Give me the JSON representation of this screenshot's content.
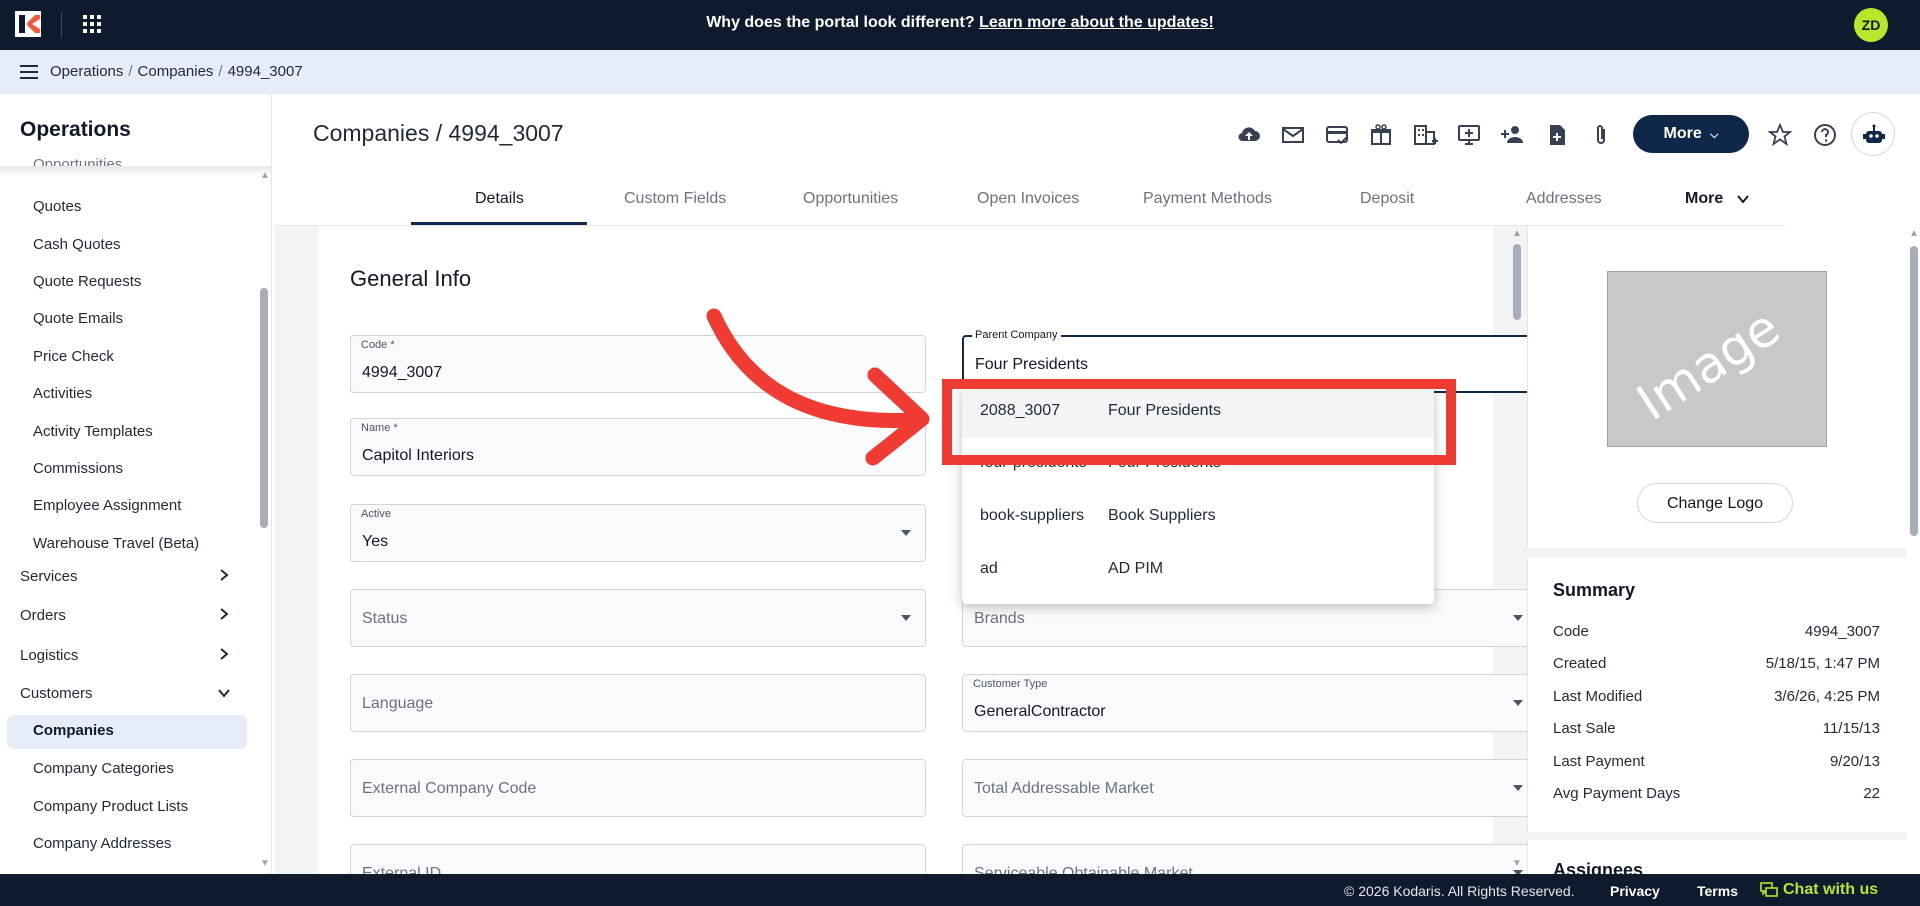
{
  "banner": {
    "question": "Why does the portal look different?",
    "link": "Learn more about the updates!"
  },
  "user": {
    "initials": "ZD"
  },
  "breadcrumb": [
    "Operations",
    "Companies",
    "4994_3007"
  ],
  "sidebar": {
    "title": "Operations",
    "clipped_item": "Opportunities",
    "items": [
      {
        "label": "Quotes"
      },
      {
        "label": "Cash Quotes"
      },
      {
        "label": "Quote Requests"
      },
      {
        "label": "Quote Emails"
      },
      {
        "label": "Price Check"
      },
      {
        "label": "Activities"
      },
      {
        "label": "Activity Templates"
      },
      {
        "label": "Commissions"
      },
      {
        "label": "Employee Assignment"
      },
      {
        "label": "Warehouse Travel (Beta)"
      }
    ],
    "sections": [
      {
        "label": "Services"
      },
      {
        "label": "Orders"
      },
      {
        "label": "Logistics"
      },
      {
        "label": "Customers"
      }
    ],
    "customer_items": [
      {
        "label": "Companies"
      },
      {
        "label": "Company Categories"
      },
      {
        "label": "Company Product Lists"
      },
      {
        "label": "Company Addresses"
      }
    ]
  },
  "page": {
    "title": "Companies / 4994_3007",
    "more_label": "More"
  },
  "toolbar_icons": [
    "cloud-upload-icon",
    "mail-icon",
    "payment-card-icon",
    "gift-icon",
    "buildings-icon",
    "add-presentation-icon",
    "add-person-icon",
    "add-document-icon",
    "paperclip-icon"
  ],
  "tabs": [
    {
      "label": "Details"
    },
    {
      "label": "Custom Fields"
    },
    {
      "label": "Opportunities"
    },
    {
      "label": "Open Invoices"
    },
    {
      "label": "Payment Methods"
    },
    {
      "label": "Deposit"
    },
    {
      "label": "Addresses"
    }
  ],
  "tabs_more": "More",
  "general_info": {
    "title": "General Info",
    "code": {
      "label": "Code *",
      "value": "4994_3007"
    },
    "name": {
      "label": "Name *",
      "value": "Capitol Interiors"
    },
    "active": {
      "label": "Active",
      "value": "Yes"
    },
    "status": {
      "placeholder": "Status"
    },
    "language": {
      "placeholder": "Language"
    },
    "external_code": {
      "placeholder": "External Company Code"
    },
    "external_id": {
      "placeholder": "External ID"
    },
    "parent_company": {
      "label": "Parent Company",
      "value": "Four Presidents"
    },
    "brands": {
      "placeholder": "Brands"
    },
    "customer_type": {
      "label": "Customer Type",
      "value": "GeneralContractor"
    },
    "tam": {
      "placeholder": "Total Addressable Market"
    },
    "som": {
      "placeholder": "Serviceable Obtainable Market"
    }
  },
  "dropdown_options": [
    {
      "code": "2088_3007",
      "name": "Four Presidents"
    },
    {
      "code": "four-presidents",
      "name": "Four Presidents"
    },
    {
      "code": "book-suppliers",
      "name": "Book Suppliers"
    },
    {
      "code": "ad",
      "name": "AD PIM"
    }
  ],
  "logo_panel": {
    "placeholder_text": "Image",
    "change_label": "Change Logo"
  },
  "summary": {
    "title": "Summary",
    "rows": [
      {
        "label": "Code",
        "value": "4994_3007"
      },
      {
        "label": "Created",
        "value": "5/18/15, 1:47 PM"
      },
      {
        "label": "Last Modified",
        "value": "3/6/26, 4:25 PM"
      },
      {
        "label": "Last Sale",
        "value": "11/15/13"
      },
      {
        "label": "Last Payment",
        "value": "9/20/13"
      },
      {
        "label": "Avg Payment Days",
        "value": "22"
      }
    ],
    "assignees_title": "Assignees"
  },
  "footer": {
    "copyright": "© 2026 Kodaris. All Rights Reserved.",
    "privacy": "Privacy",
    "terms": "Terms",
    "chat": "Chat with us"
  },
  "colors": {
    "navy": "#0f1a2e",
    "accent_navy": "#0f2748",
    "lime": "#b8e62a",
    "annotation_red": "#ef3b32"
  }
}
